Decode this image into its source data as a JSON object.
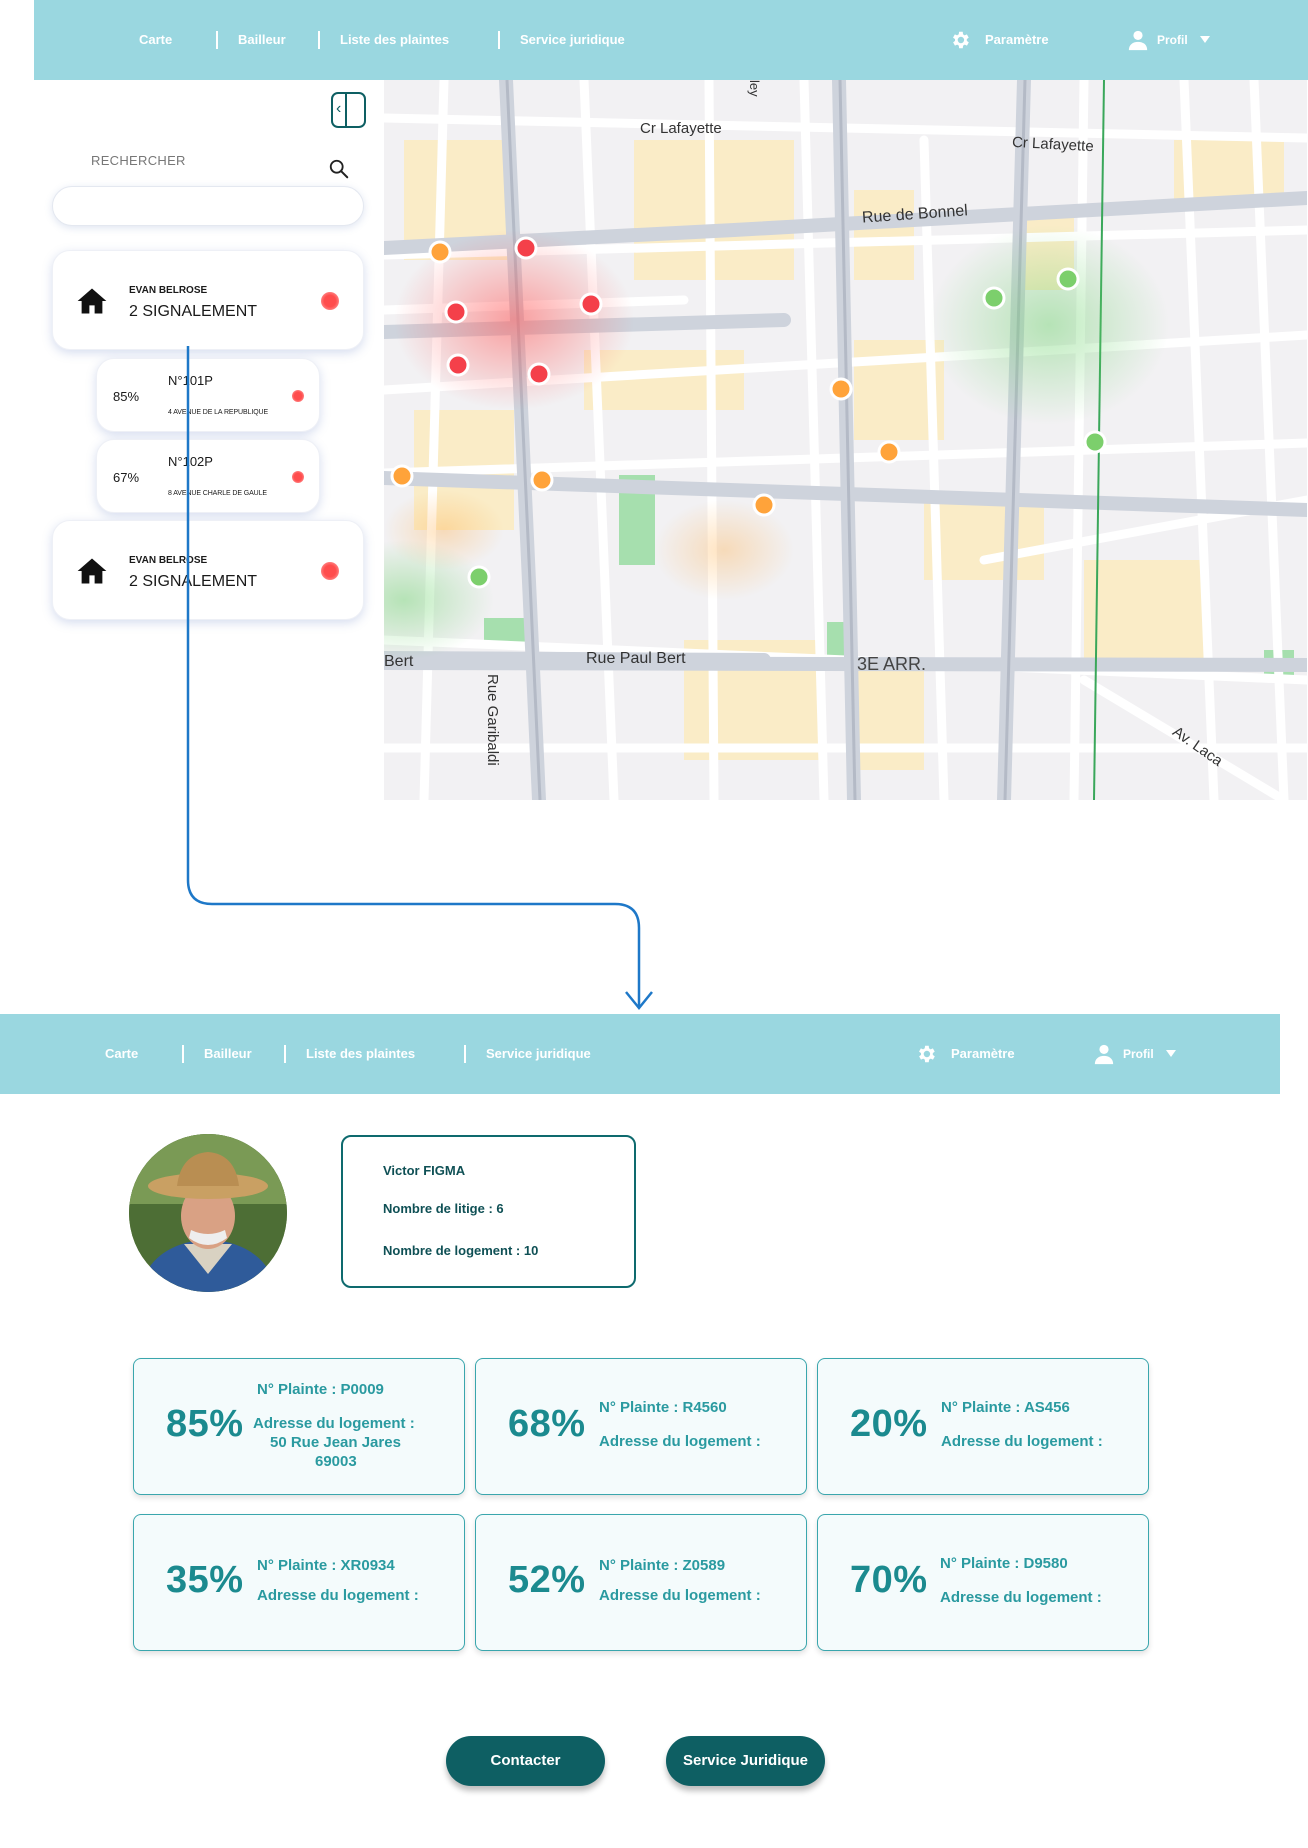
{
  "nav": {
    "carte": "Carte",
    "bailleur": "Bailleur",
    "liste": "Liste des plaintes",
    "juridique": "Service juridique",
    "parametre": "Paramètre",
    "profil": "Profil"
  },
  "sidebar": {
    "search_label": "RECHERCHER",
    "search_value": "",
    "owners": [
      {
        "name": "EVAN BELROSE",
        "count": "2 SIGNALEMENT",
        "status_color": "#ff4d4d"
      },
      {
        "name": "EVAN BELROSE",
        "count": "2 SIGNALEMENT",
        "status_color": "#ff4d4d"
      }
    ],
    "reports": [
      {
        "pct": "85%",
        "num": "N°101P",
        "addr": "4 AVENUE DE LA REPUBLIQUE"
      },
      {
        "pct": "67%",
        "num": "N°102P",
        "addr": "8 AVENUE CHARLE DE GAULE"
      }
    ]
  },
  "map": {
    "labels": {
      "lafayette1": "Cr Lafayette",
      "lafayette2": "Cr Lafayette",
      "bonnel": "Rue de Bonnel",
      "garibaldi": "Rue Garibaldi",
      "paulbert": "Rue Paul Bert",
      "bert": "Bert",
      "arr": "3E ARR.",
      "lacassagne": "Av. Laca",
      "ley": "ley"
    },
    "marker_colors": {
      "red": "#f4404a",
      "orange": "#ffa33a",
      "green": "#7ccf6c"
    }
  },
  "profile": {
    "name": "Victor FIGMA",
    "litige": "Nombre de litige :   6",
    "logement": "Nombre de logement : 10"
  },
  "plaintes": [
    {
      "pct": "85%",
      "num": "N° Plainte  :   P0009",
      "addr_label": "Adresse du logement :",
      "addr_line1": "50 Rue Jean Jares",
      "addr_line2": "69003"
    },
    {
      "pct": "68%",
      "num": "N° Plainte :  R4560",
      "addr_label": "Adresse du logement :"
    },
    {
      "pct": "20%",
      "num": "N° Plainte :  AS456",
      "addr_label": "Adresse du logement :"
    },
    {
      "pct": "35%",
      "num": "N° Plainte  :  XR0934",
      "addr_label": "Adresse du logement :"
    },
    {
      "pct": "52%",
      "num": "N° Plainte :  Z0589",
      "addr_label": "Adresse du logement :"
    },
    {
      "pct": "70%",
      "num": "N° Plainte :  D9580",
      "addr_label": "Adresse du logement :"
    }
  ],
  "actions": {
    "contacter": "Contacter",
    "juridique": "Service Juridique"
  },
  "colors": {
    "navbar": "#9ad7e0",
    "accent": "#0e5f63",
    "teal_text": "#1b8a8f",
    "flow_arrow": "#1e78c8"
  }
}
